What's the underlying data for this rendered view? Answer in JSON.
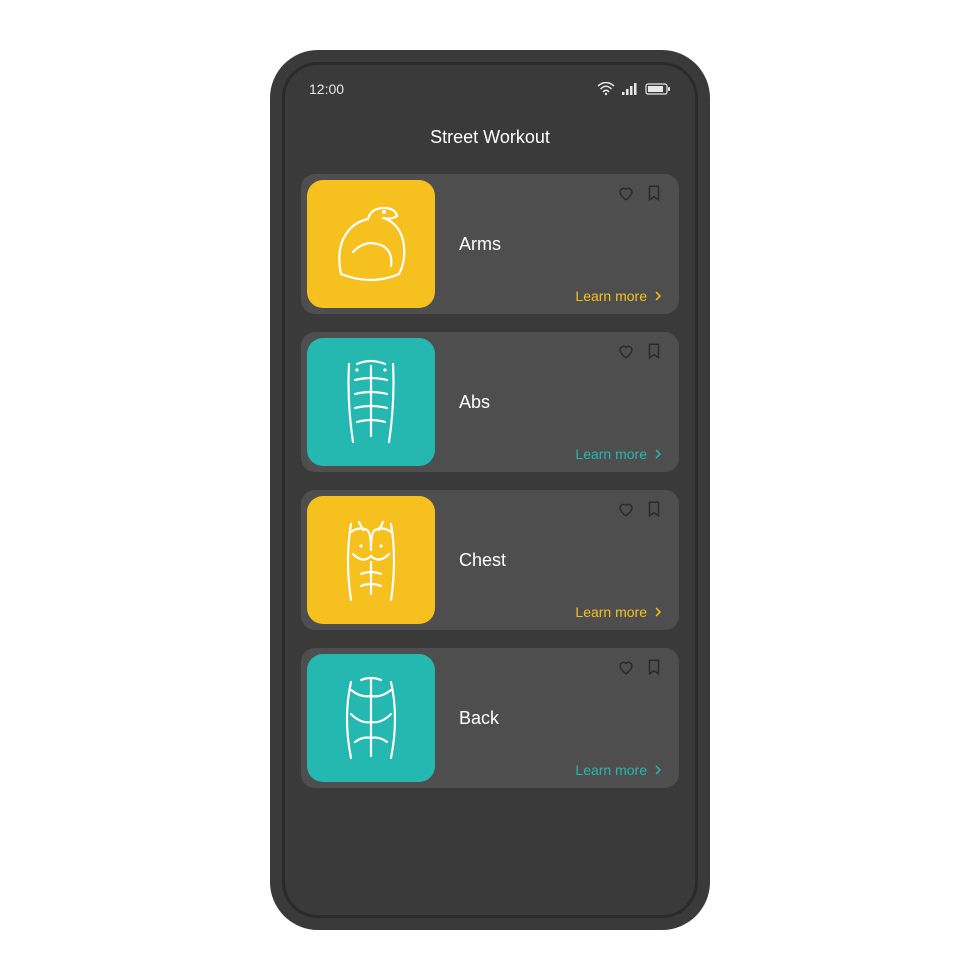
{
  "status": {
    "time": "12:00"
  },
  "header": {
    "title": "Street Workout"
  },
  "learn_label": "Learn more",
  "cards": [
    {
      "title": "Arms",
      "accent": "yellow",
      "icon": "bicep-icon"
    },
    {
      "title": "Abs",
      "accent": "teal",
      "icon": "abs-icon"
    },
    {
      "title": "Chest",
      "accent": "yellow",
      "icon": "chest-icon"
    },
    {
      "title": "Back",
      "accent": "teal",
      "icon": "back-icon"
    }
  ],
  "colors": {
    "yellow": "#f6c01f",
    "teal": "#24b8b1",
    "card": "#4e4e4e",
    "bg": "#3a3a3a"
  }
}
